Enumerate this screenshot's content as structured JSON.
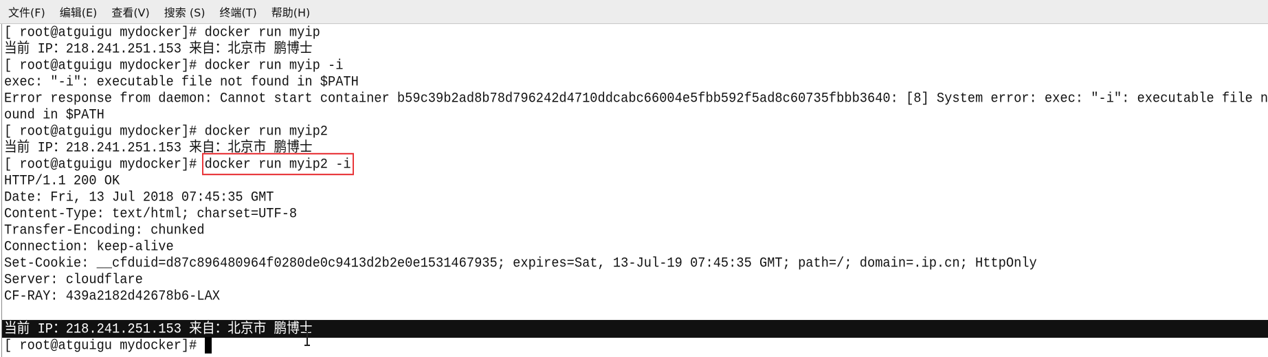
{
  "menu": [
    "文件(F)",
    "编辑(E)",
    "查看(V)",
    "搜索 (S)",
    "终端(T)",
    "帮助(H)"
  ],
  "prompt": "[ root@atguigu mydocker]# ",
  "lines": [
    {
      "cmd": "docker run myip"
    },
    {
      "text": "当前 IP：218.241.251.153 来自：北京市 鹏博士"
    },
    {
      "cmd": "docker run myip -i"
    },
    {
      "text": "exec: \"-i\": executable file not found in $PATH"
    },
    {
      "text": "Error response from daemon: Cannot start container b59c39b2ad8b78d796242d4710ddcabc66004e5fbb592f5ad8c60735fbbb3640: [8] System error: exec: \"-i\": executable file n"
    },
    {
      "text": "ound in $PATH"
    },
    {
      "cmd": "docker run myip2"
    },
    {
      "text": "当前 IP：218.241.251.153 来自：北京市 鹏博士"
    },
    {
      "cmd": "docker run myip2 -i"
    },
    {
      "text": "HTTP/1.1 200 OK"
    },
    {
      "text": "Date: Fri, 13 Jul 2018 07:45:35 GMT"
    },
    {
      "text": "Content-Type: text/html; charset=UTF-8"
    },
    {
      "text": "Transfer-Encoding: chunked"
    },
    {
      "text": "Connection: keep-alive"
    },
    {
      "text": "Set-Cookie: __cfduid=d87c896480964f0280de0c9413d2b2e0e1531467935; expires=Sat, 13-Jul-19 07:45:35 GMT; path=/; domain=.ip.cn; HttpOnly"
    },
    {
      "text": "Server: cloudflare"
    },
    {
      "text": "CF-RAY: 439a2182d42678b6-LAX"
    },
    {
      "text": ""
    },
    {
      "text": "当前 IP：218.241.251.153 来自：北京市 鹏博士"
    }
  ],
  "highlight_color": "#e8363a"
}
